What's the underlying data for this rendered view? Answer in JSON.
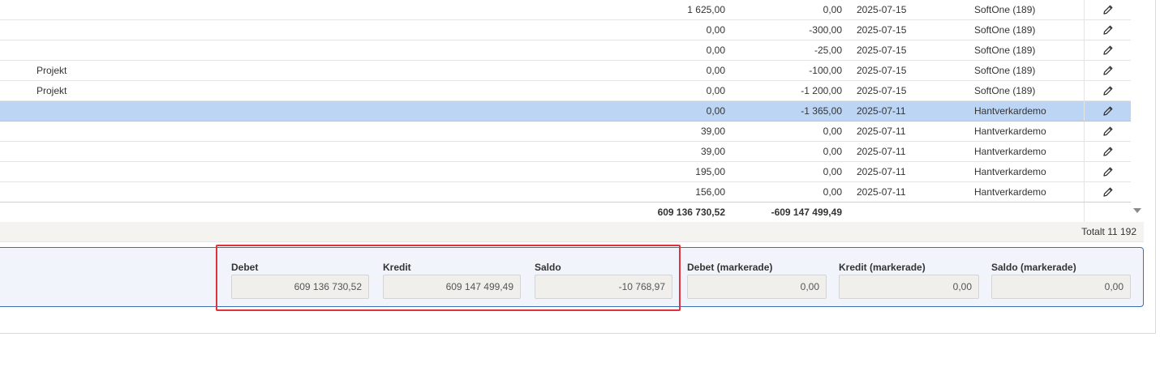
{
  "rows": [
    {
      "note": "",
      "debet": "1 625,00",
      "kredit": "0,00",
      "date": "2025-07-15",
      "user": "SoftOne (189)",
      "selected": false
    },
    {
      "note": "",
      "debet": "0,00",
      "kredit": "-300,00",
      "date": "2025-07-15",
      "user": "SoftOne (189)",
      "selected": false
    },
    {
      "note": "",
      "debet": "0,00",
      "kredit": "-25,00",
      "date": "2025-07-15",
      "user": "SoftOne (189)",
      "selected": false
    },
    {
      "note": "Projekt",
      "debet": "0,00",
      "kredit": "-100,00",
      "date": "2025-07-15",
      "user": "SoftOne (189)",
      "selected": false
    },
    {
      "note": "Projekt",
      "debet": "0,00",
      "kredit": "-1 200,00",
      "date": "2025-07-15",
      "user": "SoftOne (189)",
      "selected": false
    },
    {
      "note": "",
      "debet": "0,00",
      "kredit": "-1 365,00",
      "date": "2025-07-11",
      "user": "Hantverkardemo",
      "selected": true
    },
    {
      "note": "",
      "debet": "39,00",
      "kredit": "0,00",
      "date": "2025-07-11",
      "user": "Hantverkardemo",
      "selected": false
    },
    {
      "note": "",
      "debet": "39,00",
      "kredit": "0,00",
      "date": "2025-07-11",
      "user": "Hantverkardemo",
      "selected": false
    },
    {
      "note": "",
      "debet": "195,00",
      "kredit": "0,00",
      "date": "2025-07-11",
      "user": "Hantverkardemo",
      "selected": false
    },
    {
      "note": "",
      "debet": "156,00",
      "kredit": "0,00",
      "date": "2025-07-11",
      "user": "Hantverkardemo",
      "selected": false
    }
  ],
  "totals": {
    "debet": "609 136 730,52",
    "kredit": "-609 147 499,49"
  },
  "footer": {
    "total_label": "Totalt 11 192"
  },
  "summary": {
    "debet": {
      "label": "Debet",
      "value": "609 136 730,52"
    },
    "kredit": {
      "label": "Kredit",
      "value": "609 147 499,49"
    },
    "saldo": {
      "label": "Saldo",
      "value": "-10 768,97"
    },
    "debet_marked": {
      "label": "Debet (markerade)",
      "value": "0,00"
    },
    "kredit_marked": {
      "label": "Kredit (markerade)",
      "value": "0,00"
    },
    "saldo_marked": {
      "label": "Saldo (markerade)",
      "value": "0,00"
    }
  },
  "icons": {
    "edit": "pencil-icon",
    "scroll": "chevron-down-icon"
  },
  "colors": {
    "selected_row": "#bcd5f5",
    "highlight": "#e0323c",
    "summary_border": "#3b6fb6"
  }
}
